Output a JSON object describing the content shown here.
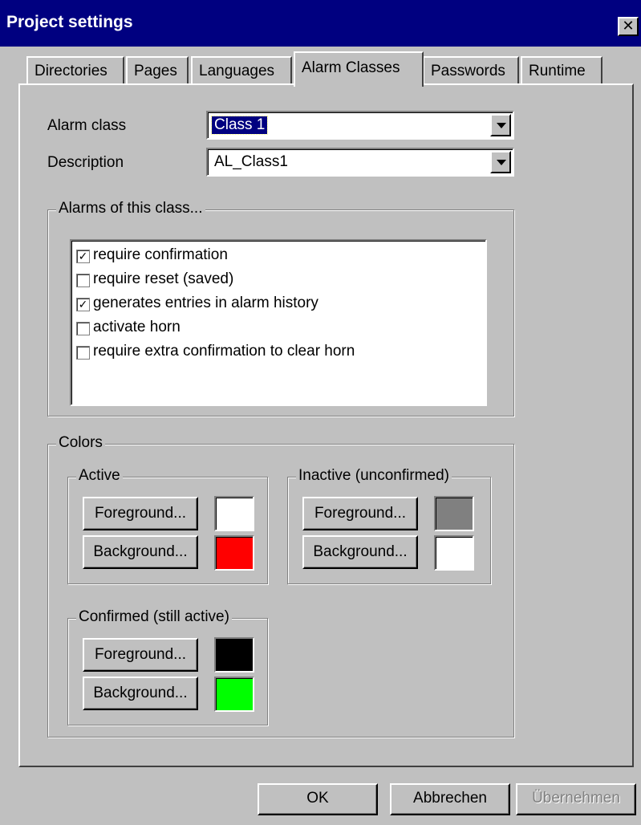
{
  "window": {
    "title": "Project settings",
    "close_glyph": "✕"
  },
  "tabs": [
    {
      "label": "Directories"
    },
    {
      "label": "Pages"
    },
    {
      "label": "Languages"
    },
    {
      "label": "Alarm Classes",
      "active": true
    },
    {
      "label": "Passwords"
    },
    {
      "label": "Runtime"
    }
  ],
  "form": {
    "alarm_class_label": "Alarm class",
    "alarm_class_value": "Class 1",
    "description_label": "Description",
    "description_value": "AL_Class1"
  },
  "alarms_group": {
    "title": "Alarms of this class...",
    "items": [
      {
        "label": "require confirmation",
        "checked": true
      },
      {
        "label": "require reset (saved)",
        "checked": false
      },
      {
        "label": "generates entries in alarm history",
        "checked": true
      },
      {
        "label": "activate horn",
        "checked": false
      },
      {
        "label": "require extra confirmation to clear horn",
        "checked": false
      }
    ]
  },
  "colors_group": {
    "title": "Colors",
    "active": {
      "title": "Active",
      "foreground_label": "Foreground...",
      "background_label": "Background...",
      "foreground_color": "#ffffff",
      "background_color": "#ff0000"
    },
    "inactive": {
      "title": "Inactive (unconfirmed)",
      "foreground_label": "Foreground...",
      "background_label": "Background...",
      "foreground_color": "#808080",
      "background_color": "#ffffff"
    },
    "confirmed": {
      "title": "Confirmed (still active)",
      "foreground_label": "Foreground...",
      "background_label": "Background...",
      "foreground_color": "#000000",
      "background_color": "#00ff00"
    }
  },
  "footer": {
    "ok_label": "OK",
    "cancel_label": "Abbrechen",
    "apply_label": "Übernehmen"
  },
  "icons": {
    "close": "close-icon",
    "dropdown": "chevron-down-icon",
    "check": "check-icon"
  }
}
